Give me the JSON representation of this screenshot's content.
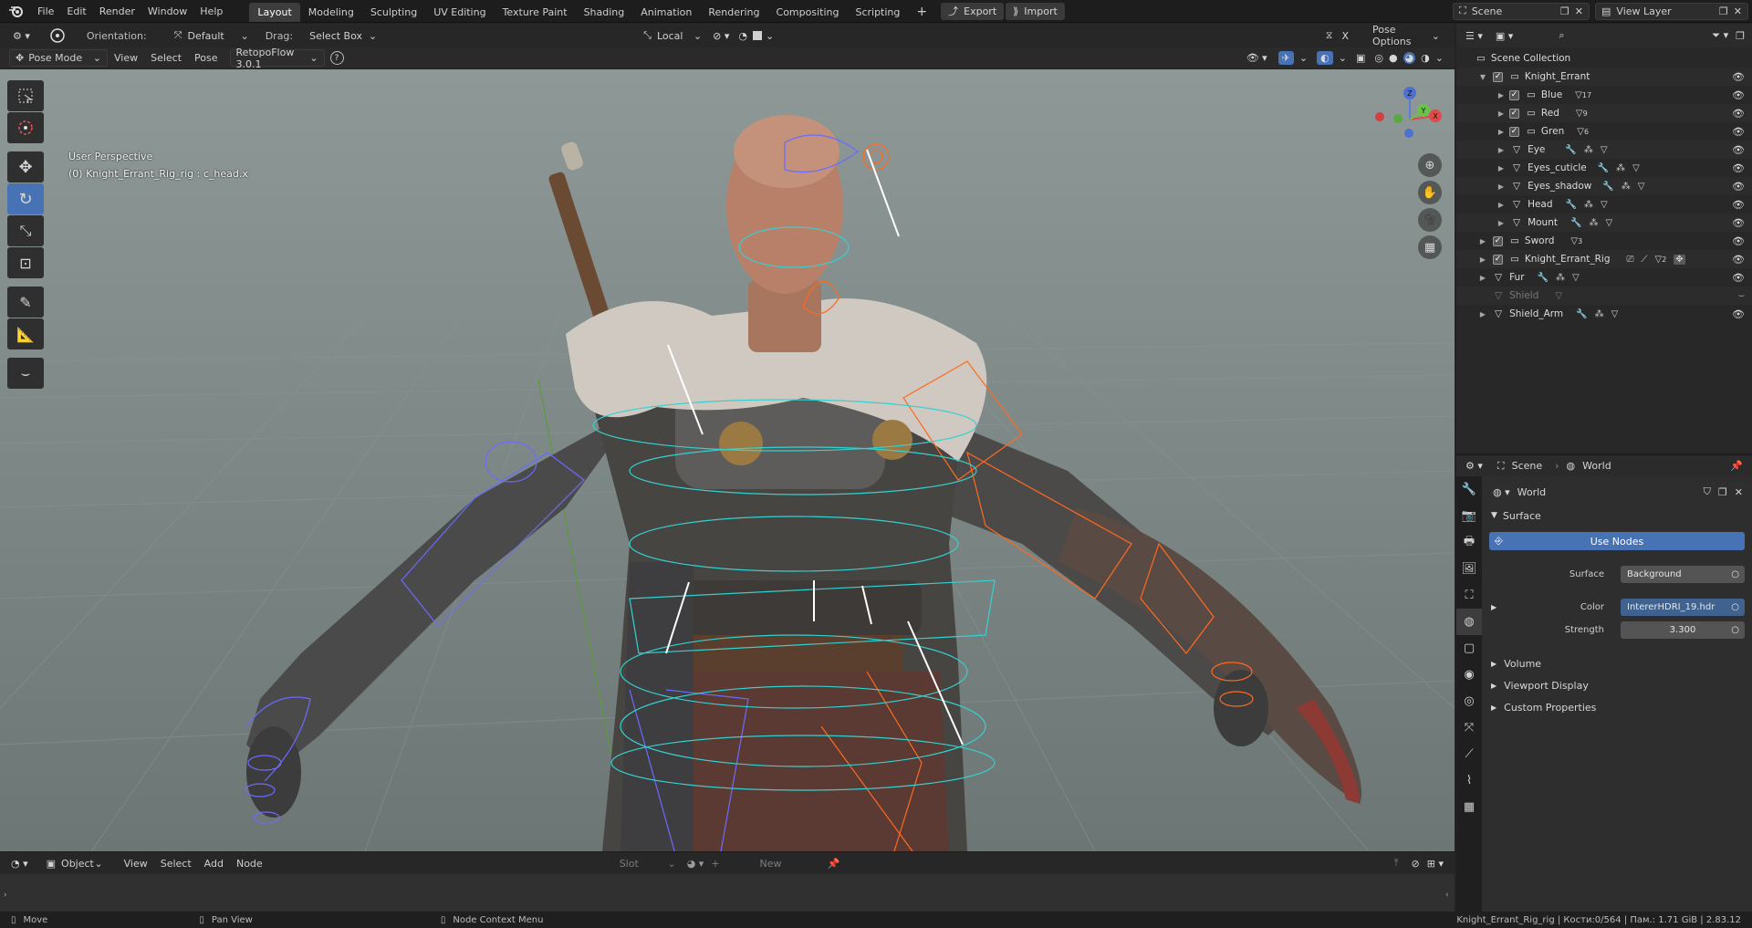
{
  "topbar": {
    "menus": [
      "File",
      "Edit",
      "Render",
      "Window",
      "Help"
    ],
    "workspaces": [
      "Layout",
      "Modeling",
      "Sculpting",
      "UV Editing",
      "Texture Paint",
      "Shading",
      "Animation",
      "Rendering",
      "Compositing",
      "Scripting"
    ],
    "active_workspace": "Layout",
    "add_tab": "+",
    "export": "Export",
    "import": "Import",
    "scene": "Scene",
    "view_layer": "View Layer"
  },
  "viewport_header": {
    "orientation_label": "Orientation:",
    "orientation_value": "Default",
    "drag_label": "Drag:",
    "drag_value": "Select Box",
    "pivot_value": "Local",
    "mirror_axis": "X",
    "pose_options": "Pose Options"
  },
  "viewport_header2": {
    "mode": "Pose Mode",
    "menus": [
      "View",
      "Select",
      "Pose"
    ],
    "retopoflow": "RetopoFlow 3.0.1",
    "help": "?"
  },
  "viewport": {
    "perspective": "User Perspective",
    "active_object": "(0) Knight_Errant_Rig_rig : c_head.x",
    "gizmo": {
      "z": "Z",
      "y": "Y",
      "x": "X"
    }
  },
  "outliner": {
    "root": "Scene Collection",
    "items": [
      {
        "name": "Knight_Errant",
        "extra": ""
      },
      {
        "name": "Blue",
        "extra": "17"
      },
      {
        "name": "Red",
        "extra": "9"
      },
      {
        "name": "Gren",
        "extra": "6"
      },
      {
        "name": "Eye",
        "extra": ""
      },
      {
        "name": "Eyes_cuticle",
        "extra": ""
      },
      {
        "name": "Eyes_shadow",
        "extra": ""
      },
      {
        "name": "Head",
        "extra": ""
      },
      {
        "name": "Mount",
        "extra": ""
      },
      {
        "name": "Sword",
        "extra": "3"
      },
      {
        "name": "Knight_Errant_Rig",
        "extra": "2"
      },
      {
        "name": "Fur",
        "extra": ""
      },
      {
        "name": "Shield",
        "extra": ""
      },
      {
        "name": "Shield_Arm",
        "extra": ""
      }
    ]
  },
  "properties": {
    "breadcrumb_scene": "Scene",
    "breadcrumb_world": "World",
    "world_name": "World",
    "surface_section": "Surface",
    "use_nodes": "Use Nodes",
    "surface_label": "Surface",
    "surface_value": "Background",
    "color_label": "Color",
    "color_value": "IntererHDRI_19.hdr",
    "strength_label": "Strength",
    "strength_value": "3.300",
    "sections": [
      "Volume",
      "Viewport Display",
      "Custom Properties"
    ]
  },
  "node_header": {
    "type": "Object",
    "menus": [
      "View",
      "Select",
      "Add",
      "Node"
    ],
    "slot": "Slot",
    "new": "New"
  },
  "statusbar": {
    "left": "Move",
    "middle": "Pan View",
    "right": "Node Context Menu",
    "stats": "Knight_Errant_Rig_rig | Кости:0/564 | Пам.: 1.71 GiB | 2.83.12"
  },
  "colors": {
    "accent": "#4772b3",
    "rig_blue": "#6b6bff",
    "rig_orange": "#ff6a1f",
    "rig_cyan": "#36d0d0"
  }
}
